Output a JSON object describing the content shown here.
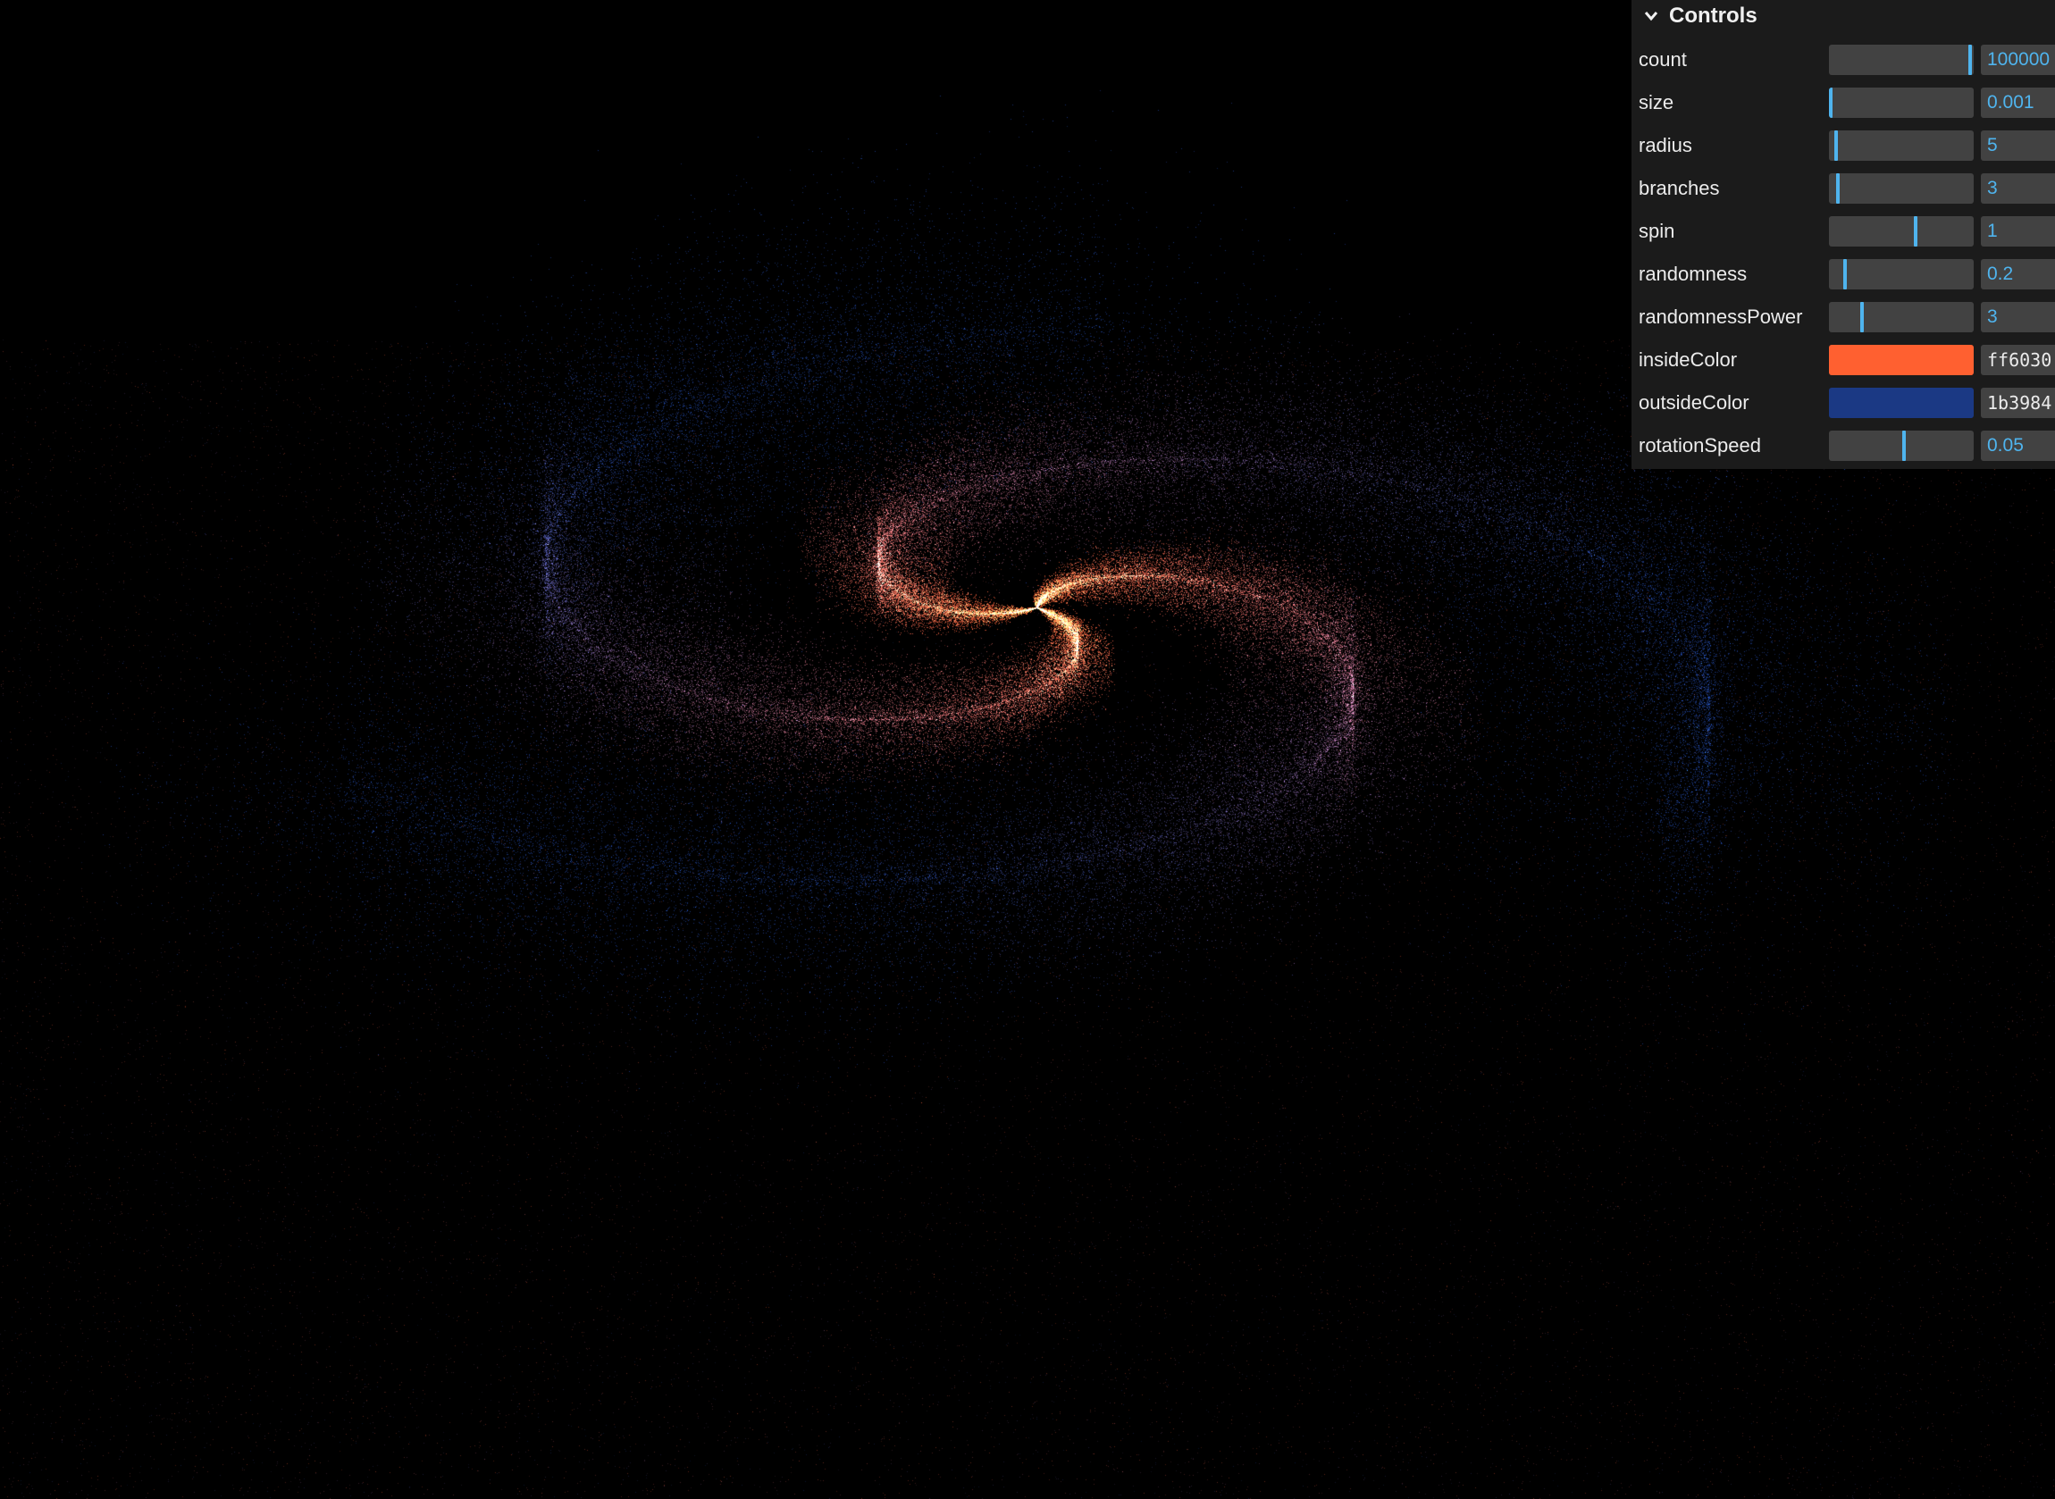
{
  "gui": {
    "title": "Controls",
    "controls": [
      {
        "label": "count",
        "type": "slider",
        "value": "100000",
        "fraction": 0.985
      },
      {
        "label": "size",
        "type": "slider",
        "value": "0.001",
        "fraction": 0.0
      },
      {
        "label": "radius",
        "type": "slider",
        "value": "5",
        "fraction": 0.04
      },
      {
        "label": "branches",
        "type": "slider",
        "value": "3",
        "fraction": 0.05
      },
      {
        "label": "spin",
        "type": "slider",
        "value": "1",
        "fraction": 0.6
      },
      {
        "label": "randomness",
        "type": "slider",
        "value": "0.2",
        "fraction": 0.1
      },
      {
        "label": "randomnessPower",
        "type": "slider",
        "value": "3",
        "fraction": 0.22
      },
      {
        "label": "insideColor",
        "type": "color",
        "value": "ff6030",
        "color": "#ff6030"
      },
      {
        "label": "outsideColor",
        "type": "color",
        "value": "1b3984",
        "color": "#1b3984"
      },
      {
        "label": "rotationSpeed",
        "type": "slider",
        "value": "0.05",
        "fraction": 0.52
      }
    ]
  },
  "colors": {
    "background": "#000000",
    "panel": "#1b1b1b",
    "accent": "#4fb4ee",
    "inside": "#ff6030",
    "outside": "#1b3984"
  },
  "icons": {
    "collapse": "chevron-down-icon"
  }
}
